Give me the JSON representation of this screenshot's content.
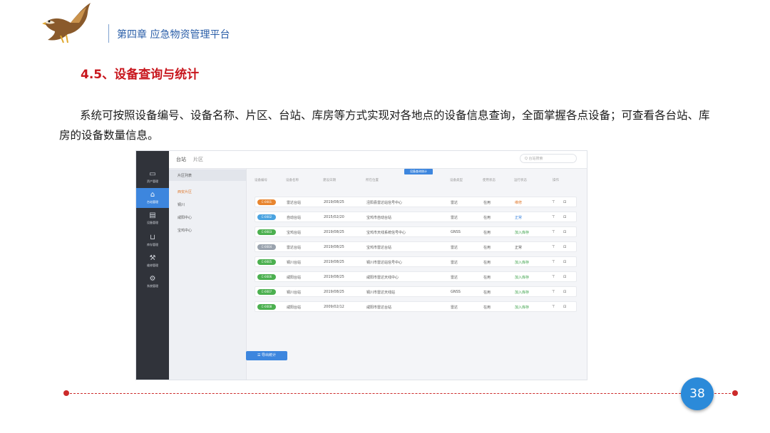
{
  "header": {
    "chapter": "第四章  应急物资管理平台"
  },
  "section_title": "4.5、设备查询与统计",
  "body_text": "系统可按照设备编号、设备名称、片区、台站、库房等方式实现对各地点的设备信息查询，全面掌握各点设备；可查看各台站、库房的设备数量信息。",
  "screenshot": {
    "sidebar": [
      {
        "icon": "folder-icon",
        "glyph": "▭",
        "label": "资产管理",
        "active": false
      },
      {
        "icon": "home-icon",
        "glyph": "⌂",
        "label": "台站管理",
        "active": true
      },
      {
        "icon": "document-icon",
        "glyph": "▤",
        "label": "设备管理",
        "active": false
      },
      {
        "icon": "box-icon",
        "glyph": "⊔",
        "label": "库存管理",
        "active": false
      },
      {
        "icon": "tool-icon",
        "glyph": "⚒",
        "label": "维修管理",
        "active": false
      },
      {
        "icon": "gear-icon",
        "glyph": "⚙",
        "label": "系统管理",
        "active": false
      }
    ],
    "tabs": [
      "台站",
      "片区"
    ],
    "search_placeholder": "Q 台站搜索",
    "tree": [
      "片区列表",
      "西安片区",
      "铜川",
      "咸阳中心",
      "宝鸡中心"
    ],
    "top_button": "设备查询统计",
    "columns": [
      "设备编号",
      "设备名称",
      "建设日期",
      "所在位置",
      "设备类型",
      "使用状态",
      "运行状态",
      "操作"
    ],
    "rows": [
      {
        "code": "C-0001",
        "name": "雷达台站",
        "date": "2019/08/25",
        "location": "泾阳县雷达站信号中心",
        "type": "雷达",
        "use": "在用",
        "status": "维修",
        "status_kind": "orange",
        "pill_color": "#e8852f"
      },
      {
        "code": "C-0002",
        "name": "自动台站",
        "date": "2015/02/20",
        "location": "宝鸡市自动台站",
        "type": "雷达",
        "use": "在用",
        "status": "正常",
        "status_kind": "blue",
        "pill_color": "#4aa3e0"
      },
      {
        "code": "C-0003",
        "name": "宝鸡台站",
        "date": "2019/08/25",
        "location": "宝鸡市天线系统信号中心",
        "type": "GNSS",
        "use": "在用",
        "status": "加入库存",
        "status_kind": "green",
        "pill_color": "#4cb050"
      },
      {
        "code": "C-0004",
        "name": "雷达台站",
        "date": "2019/08/25",
        "location": "宝鸡市雷达台站",
        "type": "雷达",
        "use": "在用",
        "status": "正常",
        "status_kind": "gray",
        "pill_color": "#9aa3ae"
      },
      {
        "code": "C-0005",
        "name": "铜川台站",
        "date": "2019/08/25",
        "location": "铜川市雷达站信号中心",
        "type": "雷达",
        "use": "在用",
        "status": "加入库存",
        "status_kind": "green",
        "pill_color": "#4cb050"
      },
      {
        "code": "C-0006",
        "name": "咸阳台站",
        "date": "2019/08/25",
        "location": "咸阳市雷达天线中心",
        "type": "雷达",
        "use": "在用",
        "status": "加入库存",
        "status_kind": "green",
        "pill_color": "#4cb050"
      },
      {
        "code": "C-0007",
        "name": "铜川台站",
        "date": "2019/08/25",
        "location": "铜川市雷达天线站",
        "type": "GNSS",
        "use": "在用",
        "status": "加入库存",
        "status_kind": "green",
        "pill_color": "#4cb050"
      },
      {
        "code": "C-0008",
        "name": "咸阳台站",
        "date": "2009/02/12",
        "location": "咸阳市雷达台站",
        "type": "雷达",
        "use": "在用",
        "status": "加入库存",
        "status_kind": "green",
        "pill_color": "#4cb050"
      }
    ],
    "action_icons": [
      "⊤",
      "⊡"
    ],
    "bottom_button": "☰ 导出统计"
  },
  "page_number": "38"
}
